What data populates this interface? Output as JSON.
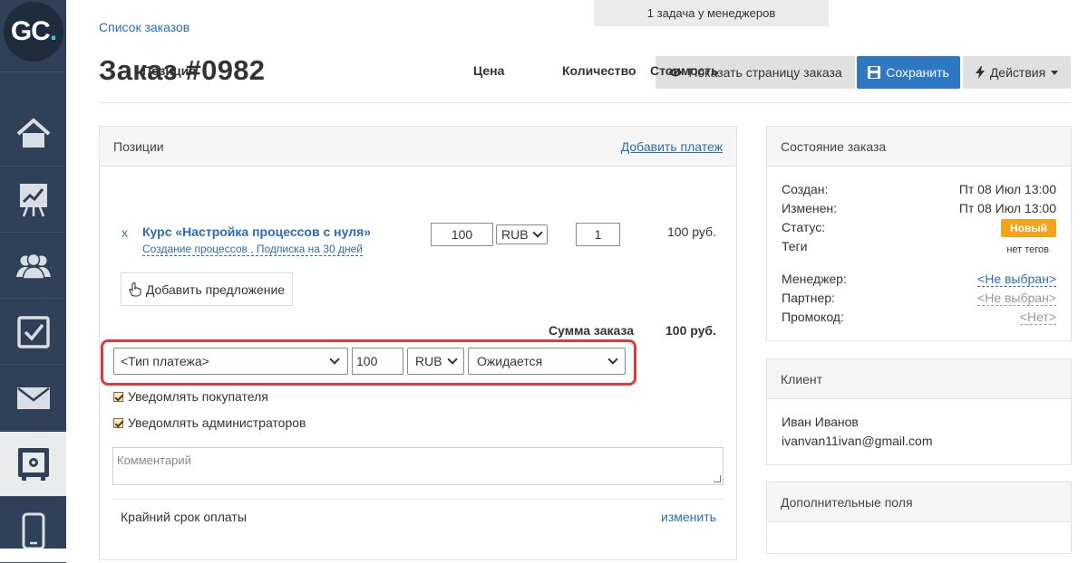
{
  "sidebar": {
    "logo": {
      "text": "GC",
      "dot": "."
    },
    "items": [
      {
        "icon": "home-icon"
      },
      {
        "icon": "chart-board-icon"
      },
      {
        "icon": "users-icon"
      },
      {
        "icon": "checkbox-icon"
      },
      {
        "icon": "mail-icon"
      },
      {
        "icon": "safe-icon",
        "active": true
      },
      {
        "icon": "mobile-icon"
      }
    ]
  },
  "notice": "1 задача у менеджеров",
  "breadcrumb": "Список заказов",
  "page_title": "Заказ #0982",
  "toolbar": {
    "show_page": "Показать страницу заказа",
    "save": "Сохранить",
    "actions": "Действия"
  },
  "positions_panel": {
    "title": "Позиции",
    "add_payment": "Добавить платеж",
    "headers": {
      "position": "Позиция",
      "price": "Цена",
      "quantity": "Количество",
      "cost": "Стоимость"
    },
    "row": {
      "remove": "x",
      "title": "Курс «Настройка процессов с нуля»",
      "subtitle": "Создание процессов , Подписка на 30 дней",
      "price": "100",
      "currency": "RUB",
      "quantity": "1",
      "cost": "100 руб."
    },
    "add_offer": "Добавить предложение",
    "sum_label": "Сумма заказа",
    "sum_value": "100 руб.",
    "payment": {
      "type": "<Тип платежа>",
      "amount": "100",
      "currency": "RUB",
      "status": "Ожидается"
    },
    "notify_buyer": "Уведомлять покупателя",
    "notify_admins": "Уведомлять администраторов",
    "comment_placeholder": "Комментарий",
    "deadline_label": "Крайний срок оплаты",
    "deadline_change": "изменить"
  },
  "state_panel": {
    "title": "Состояние заказа",
    "created_label": "Создан:",
    "created_value": "Пт 08 Июл 13:00",
    "changed_label": "Изменен:",
    "changed_value": "Пт 08 Июл 13:00",
    "status_label": "Статус:",
    "status_value": "Новый",
    "tags_label": "Теги",
    "tags_value": "нет тегов",
    "manager_label": "Менеджер:",
    "manager_value": "<Не выбран>",
    "partner_label": "Партнер:",
    "partner_value": "<Не выбран>",
    "promo_label": "Промокод:",
    "promo_value": "<Нет>"
  },
  "client_panel": {
    "title": "Клиент",
    "name": "Иван Иванов",
    "email": "ivanvan11ivan@gmail.com"
  },
  "extra_panel": {
    "title": "Дополнительные поля"
  },
  "colors": {
    "sidebar": "#2f4158",
    "accent": "#2f78c4",
    "link": "#2a6db0",
    "badge": "#f5a31a",
    "highlight": "#e0393b"
  }
}
